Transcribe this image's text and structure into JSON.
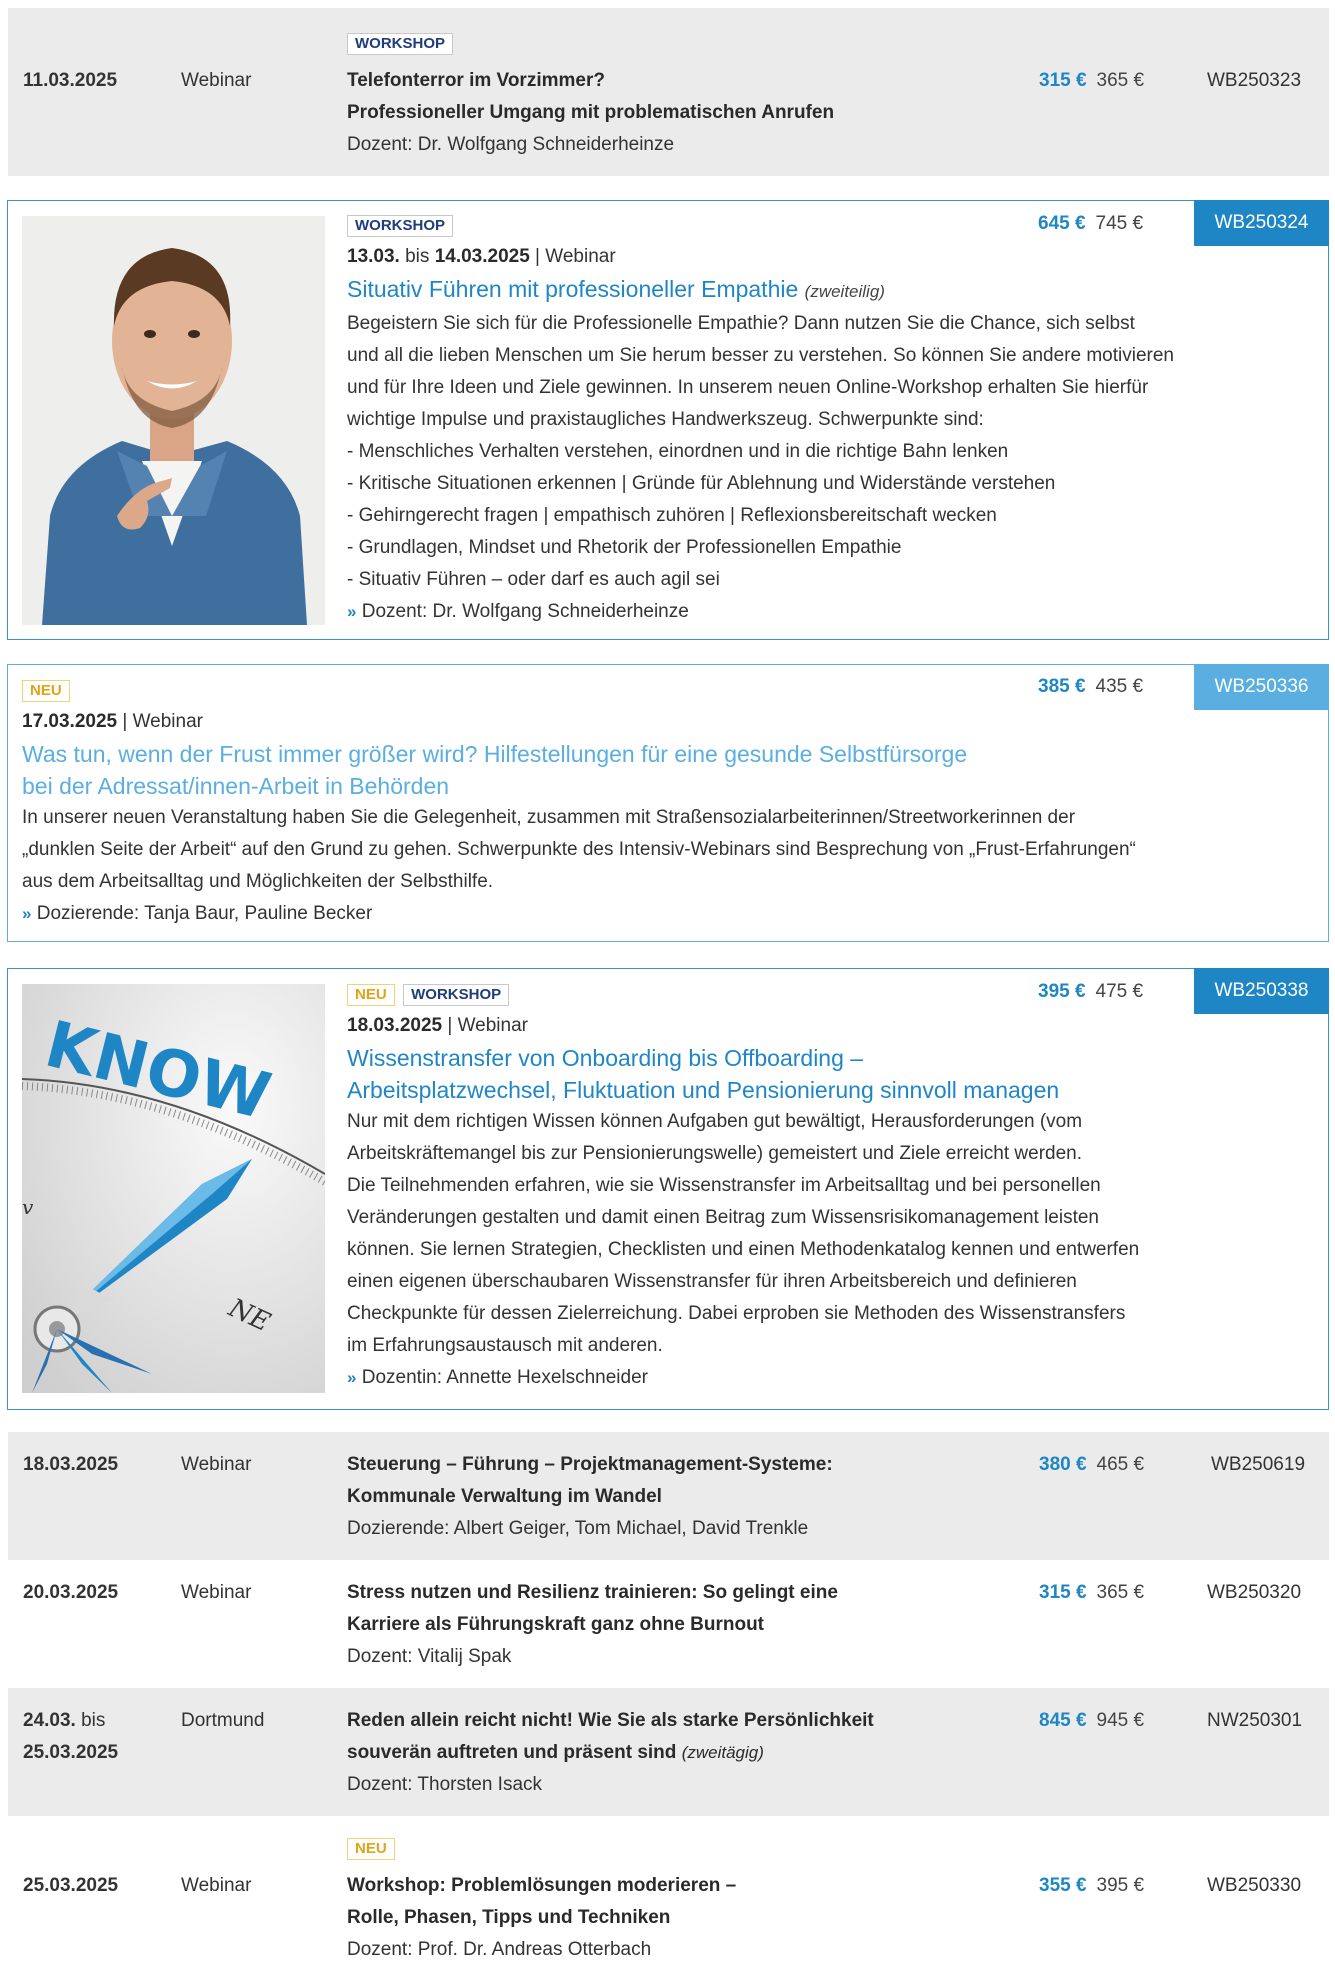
{
  "colors": {
    "accent_blue": "#1f86c6",
    "light_blue": "#5aaee0",
    "row_bg": "#ebebeb",
    "tag_workshop": "#203c7a",
    "tag_neu": "#e3a316"
  },
  "row1": {
    "tag": "WORKSHOP",
    "date": "11.03.2025",
    "location": "Webinar",
    "title_line1": "Telefonterror im Vorzimmer?",
    "title_line2": "Professioneller Umgang mit problematischen Anrufen",
    "lecturer": "Dozent: Dr. Wolfgang Schneiderheinze",
    "price": "315 €",
    "price_regular": "365 €",
    "code": "WB250323"
  },
  "card1": {
    "tag": "WORKSHOP",
    "date_from": "13.03.",
    "date_sep": " bis ",
    "date_to": "14.03.2025",
    "location": " | Webinar",
    "title": "Situativ Führen mit professioneller Empathie",
    "title_note": "(zweiteilig)",
    "desc": [
      "Begeistern Sie sich für die Professionelle Empathie? Dann nutzen Sie die Chance, sich selbst",
      "und all die lieben Menschen um Sie herum besser zu verstehen. So können Sie andere motivieren",
      "und für Ihre Ideen und Ziele gewinnen. In unserem neuen Online-Workshop erhalten Sie hierfür",
      "wichtige Impulse und praxistaugliches Handwerkszeug. Schwerpunkte sind:",
      "- Menschliches Verhalten verstehen, einordnen und in die richtige Bahn lenken",
      "- Kritische Situationen erkennen | Gründe für Ablehnung und Widerstände verstehen",
      "- Gehirngerecht fragen | empathisch zuhören | Reflexionsbereitschaft wecken",
      "- Grundlagen, Mindset und Rhetorik der Professionellen Empathie",
      "- Situativ Führen –  oder darf es auch agil sei"
    ],
    "lecturer_arrow": "»",
    "lecturer": "Dozent: Dr. Wolfgang Schneiderheinze",
    "price": "645 €",
    "price_regular": "745 €",
    "code": "WB250324"
  },
  "card2": {
    "tag": "NEU",
    "date": "17.03.2025",
    "location": " | Webinar",
    "title_line1": "Was tun, wenn der Frust immer größer wird? Hilfestellungen für eine gesunde Selbstfürsorge",
    "title_line2": "bei der Adressat/innen-Arbeit in Behörden",
    "desc": [
      "In unserer neuen Veranstaltung haben Sie die Gelegenheit, zusammen mit Straßensozialarbeiterinnen/Streetworkerinnen der",
      "„dunklen Seite der Arbeit“ auf den Grund zu gehen. Schwerpunkte des Intensiv-Webinars sind Besprechung von „Frust-Erfahrungen“",
      "aus dem Arbeitsalltag und Möglichkeiten der Selbsthilfe."
    ],
    "lecturer_arrow": "»",
    "lecturer": "Dozierende: Tanja Baur, Pauline Becker",
    "price": "385 €",
    "price_regular": "435 €",
    "code": "WB250336"
  },
  "card3": {
    "tag1": "NEU",
    "tag2": "WORKSHOP",
    "date": "18.03.2025",
    "location": " | Webinar",
    "title_line1": "Wissenstransfer von Onboarding bis Offboarding –",
    "title_line2": "Arbeitsplatzwechsel, Fluktuation und Pensionierung sinnvoll managen",
    "desc": [
      "Nur mit dem richtigen Wissen können Aufgaben gut bewältigt, Herausforderungen (vom",
      "Arbeitskräftemangel bis zur Pensionierungswelle) gemeistert und Ziele erreicht werden.",
      "Die Teilnehmenden erfahren, wie sie Wissenstransfer im Arbeitsalltag und bei personellen",
      "Veränderungen gestalten und damit einen Beitrag zum Wissensrisikomanagement leisten",
      "können. Sie lernen Strategien, Checklisten und einen Methodenkatalog kennen und entwerfen",
      "einen eigenen überschaubaren Wissenstransfer für ihren Arbeitsbereich und definieren",
      "Checkpunkte für dessen Zielerreichung. Dabei erproben sie Methoden des Wissenstransfers",
      "im Erfahrungsaustausch mit anderen."
    ],
    "lecturer_arrow": "»",
    "lecturer": "Dozentin: Annette Hexelschneider",
    "image_text": "KNOW",
    "price": "395 €",
    "price_regular": "475 €",
    "code": "WB250338"
  },
  "row2": {
    "date": "18.03.2025",
    "location": "Webinar",
    "title_line1": "Steuerung – Führung – Projektmanagement-Systeme:",
    "title_line2": "Kommunale Verwaltung im Wandel",
    "lecturer": "Dozierende: Albert Geiger, Tom Michael, David Trenkle",
    "price": "380 €",
    "price_regular": "465 €",
    "code": "WB250619"
  },
  "row3": {
    "date": "20.03.2025",
    "location": "Webinar",
    "title_line1": "Stress nutzen und Resilienz trainieren: So gelingt eine",
    "title_line2": "Karriere als Führungskraft ganz ohne Burnout",
    "lecturer": "Dozent: Vitalij Spak",
    "price": "315 €",
    "price_regular": "365 €",
    "code": "WB250320"
  },
  "row4": {
    "date_from": "24.03.",
    "date_sep": " bis",
    "date_to": "25.03.2025",
    "location": "Dortmund",
    "title_line1": "Reden allein reicht nicht! Wie Sie als starke Persönlichkeit",
    "title_line2": "souverän auftreten und präsent sind",
    "title_note": "(zweitägig)",
    "lecturer": "Dozent: Thorsten Isack",
    "price": "845 €",
    "price_regular": "945 €",
    "code": "NW250301"
  },
  "row5": {
    "tag": "NEU",
    "date": "25.03.2025",
    "location": "Webinar",
    "title_line1": "Workshop: Problemlösungen moderieren –",
    "title_line2": "Rolle, Phasen, Tipps und Techniken",
    "lecturer": "Dozent: Prof. Dr. Andreas Otterbach",
    "price": "355 €",
    "price_regular": "395 €",
    "code": "WB250330"
  }
}
